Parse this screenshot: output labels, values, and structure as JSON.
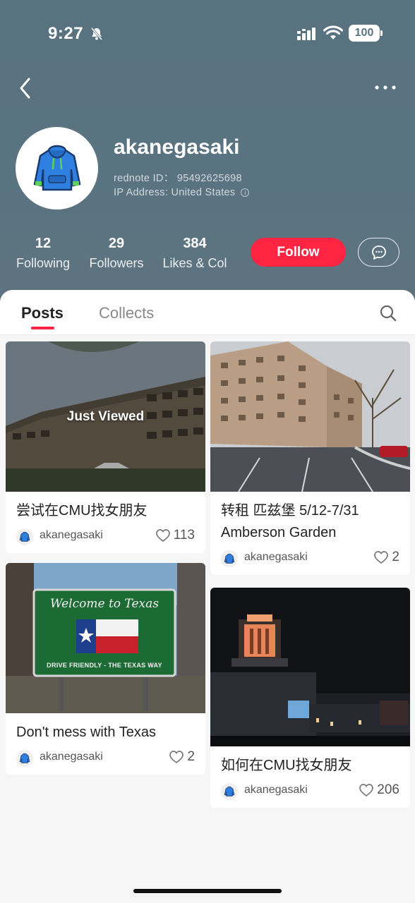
{
  "status_bar": {
    "time": "9:27",
    "battery": "100"
  },
  "profile": {
    "username": "akanegasaki",
    "rednote_id": "rednote ID： 95492625698",
    "ip_address": "IP Address: United States",
    "stats": [
      {
        "value": "12",
        "label": "Following"
      },
      {
        "value": "29",
        "label": "Followers"
      },
      {
        "value": "384",
        "label": "Likes & Col"
      }
    ],
    "follow_label": "Follow"
  },
  "tabs": {
    "posts": "Posts",
    "collects": "Collects",
    "active": "Posts"
  },
  "posts": [
    {
      "title": "尝试在CMU找女朋友",
      "author": "akanegasaki",
      "likes": "113",
      "overlay": "Just Viewed"
    },
    {
      "title": "转租 匹兹堡 5/12-7/31 Amberson Garden",
      "author": "akanegasaki",
      "likes": "2"
    },
    {
      "title": "Don't mess with Texas",
      "author": "akanegasaki",
      "likes": "2"
    },
    {
      "title": "如何在CMU找女朋友",
      "author": "akanegasaki",
      "likes": "206"
    }
  ],
  "images": {
    "texas_sign_line1": "Welcome to Texas",
    "texas_sign_line2": "DRIVE FRIENDLY - THE TEXAS WAY"
  },
  "colors": {
    "accent": "#ff2442",
    "header_bg": "#5a7381"
  }
}
